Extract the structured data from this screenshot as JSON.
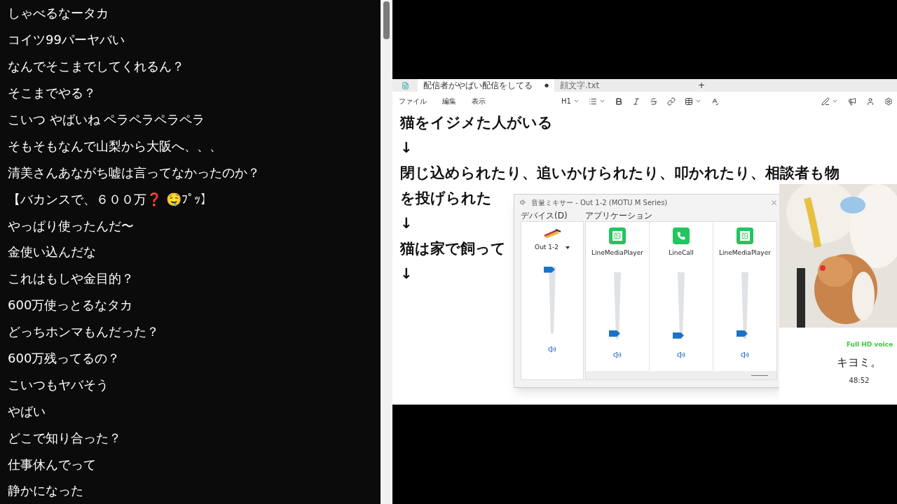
{
  "chat": {
    "messages": [
      "しゃべるなータカ",
      "コイツ99パーヤバい",
      "なんでそこまでしてくれるん？",
      "そこまでやる？",
      "こいつ やばいね ペラペラペラペラ",
      "そもそもなんで山梨から大阪へ、、、",
      "清美さんあながち嘘は言ってなかったのか？",
      "【バカンスで、６００万❓ 🤤ﾌﾟｯ】",
      "やっぱり使ったんだ〜",
      "金使い込んだな",
      "これはもしや金目的？",
      "600万使っとるなタカ",
      "どっちホンマもんだった？",
      "600万残ってるの？",
      "こいつもヤバそう",
      "やばい",
      "どこで知り合った？",
      "仕事休んでって",
      "静かになった"
    ]
  },
  "editor": {
    "tabs": [
      {
        "label": "配信者がやばい配信をしてる",
        "mark": "●",
        "selected": true
      },
      {
        "label": "顔文字.txt",
        "selected": false
      }
    ],
    "new_tab": "+",
    "menu": [
      "ファイル",
      "編集",
      "表示"
    ],
    "heading": "H1",
    "lines": [
      "猫をイジメた人がいる",
      "↓",
      "閉じ込められたり、追いかけられたり、叩かれたり、相談者も物",
      "を投げられた",
      "↓",
      "猫は家で飼って",
      "↓"
    ]
  },
  "mixer": {
    "title": "音量ミキサー - Out 1-2 (MOTU M Series)",
    "device_label": "デバイス(D)",
    "apps_label": "アプリケーション",
    "device": {
      "name": "Out 1-2",
      "level": 1
    },
    "apps": [
      {
        "name": "LineMediaPlayer",
        "kind": "media",
        "level": 0.05
      },
      {
        "name": "LineCall",
        "kind": "call",
        "level": 0.02
      },
      {
        "name": "LineMediaPlayer",
        "kind": "media",
        "level": 0.05
      }
    ]
  },
  "call": {
    "badge": "Full HD voice",
    "name": "キヨミ。",
    "time": "48:52"
  }
}
